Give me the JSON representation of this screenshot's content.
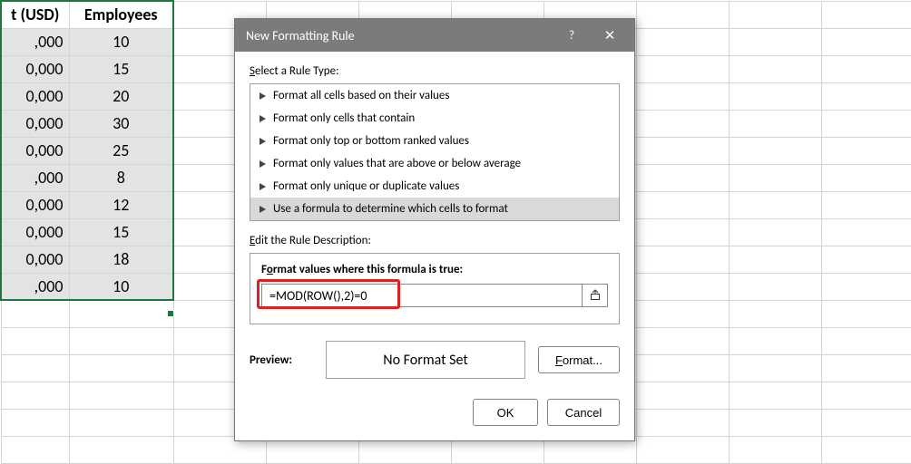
{
  "sheet": {
    "headers": [
      "t (USD)",
      "Employees"
    ],
    "col_a_values": [
      ",000",
      "0,000",
      "0,000",
      "0,000",
      "0,000",
      ",000",
      "0,000",
      "0,000",
      "0,000",
      ",000"
    ],
    "col_b_values": [
      "10",
      "15",
      "20",
      "30",
      "25",
      "8",
      "12",
      "15",
      "18",
      "10"
    ]
  },
  "dialog": {
    "title": "New Formatting Rule",
    "help_glyph": "?",
    "close_glyph": "✕",
    "select_label_pre": "S",
    "select_label_rest": "elect a Rule Type:",
    "rule_types": [
      "Format all cells based on their values",
      "Format only cells that contain",
      "Format only top or bottom ranked values",
      "Format only values that are above or below average",
      "Format only unique or duplicate values",
      "Use a formula to determine which cells to format"
    ],
    "rule_types_selected_index": 5,
    "edit_label_pre": "E",
    "edit_label_rest": "dit the Rule Description:",
    "formula_label_pre": "F",
    "formula_label_mid": "o",
    "formula_label_rest": "rmat values where this formula is true:",
    "formula_value": "=MOD(ROW(),2)=0",
    "preview_label": "Preview:",
    "preview_text": "No Format Set",
    "format_btn_pre": "F",
    "format_btn_rest": "ormat...",
    "ok_label": "OK",
    "cancel_label": "Cancel"
  }
}
